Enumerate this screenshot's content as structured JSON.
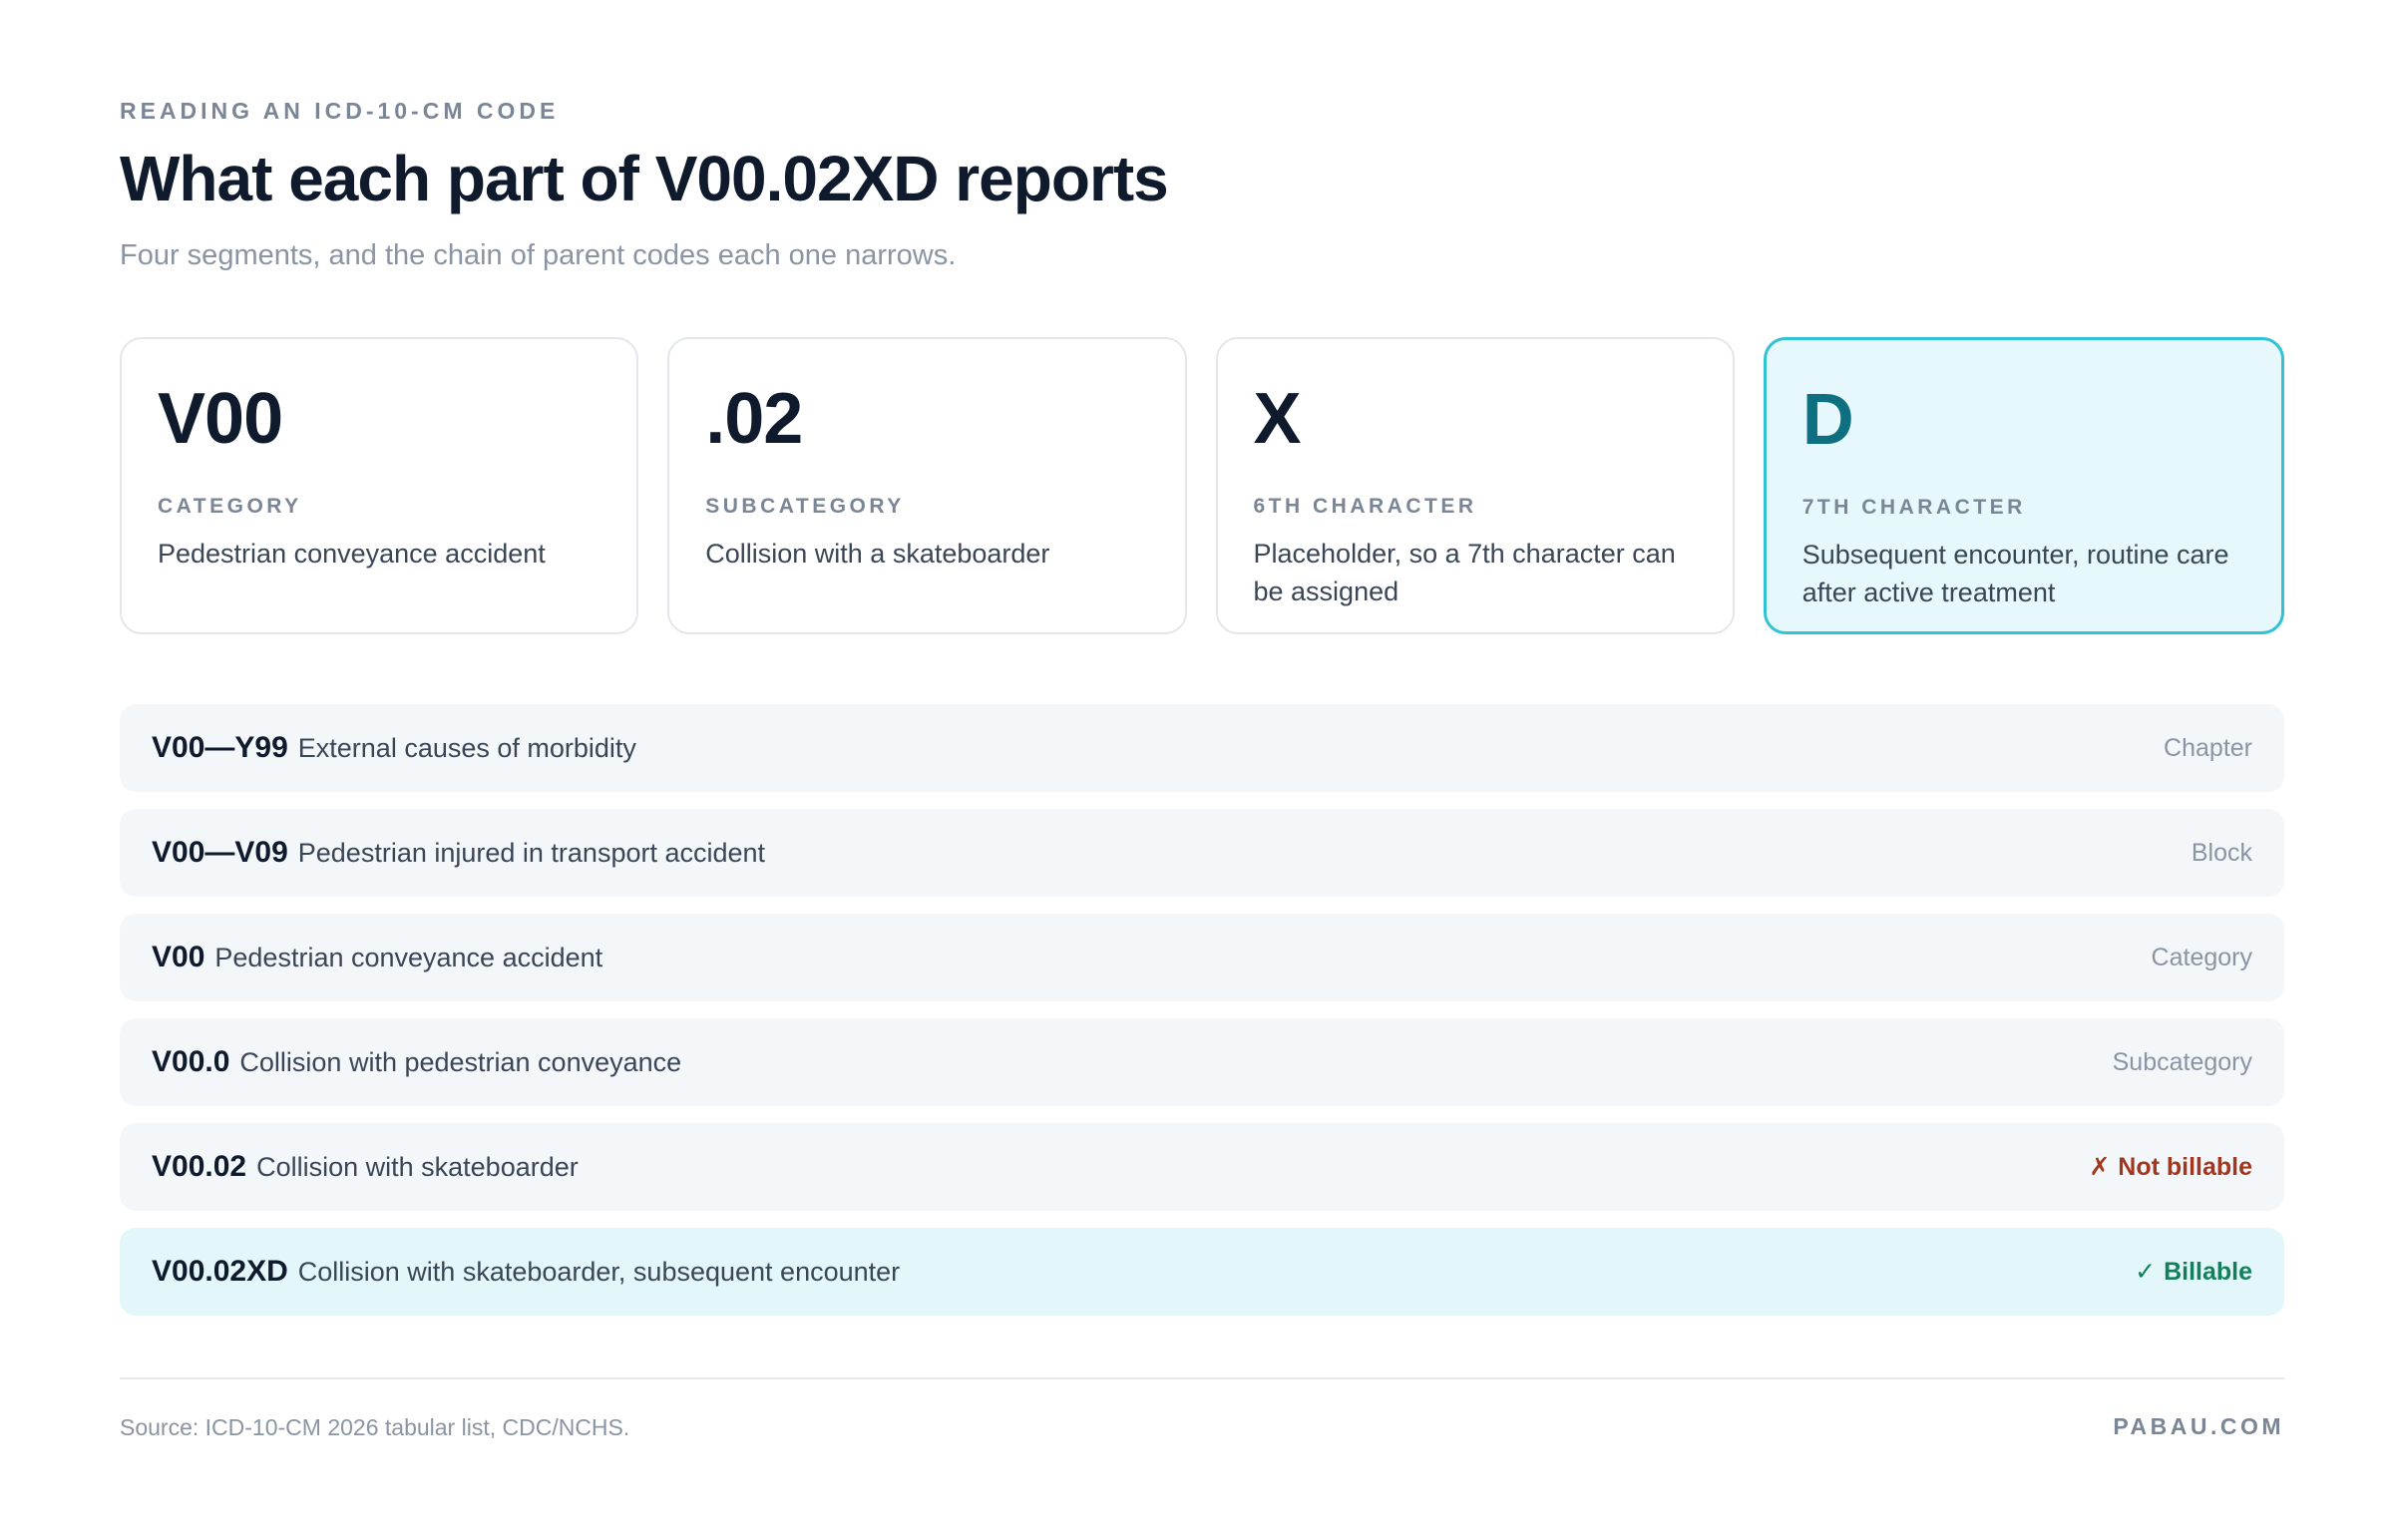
{
  "header": {
    "eyebrow": "READING AN ICD-10-CM CODE",
    "title": "What each part of V00.02XD reports",
    "subtitle": "Four segments, and the chain of parent codes each one narrows."
  },
  "segments": [
    {
      "code": "V00",
      "label": "CATEGORY",
      "description": "Pedestrian conveyance accident",
      "highlighted": false
    },
    {
      "code": ".02",
      "label": "SUBCATEGORY",
      "description": "Collision with a skateboarder",
      "highlighted": false
    },
    {
      "code": "X",
      "label": "6TH CHARACTER",
      "description": "Placeholder, so a 7th character can be assigned",
      "highlighted": false
    },
    {
      "code": "D",
      "label": "7TH CHARACTER",
      "description": "Subsequent encounter, routine care after active treatment",
      "highlighted": true
    }
  ],
  "hierarchy": [
    {
      "code": "V00—Y99",
      "description": "External causes of morbidity",
      "level": "Chapter",
      "status": "",
      "mark": ""
    },
    {
      "code": "V00—V09",
      "description": "Pedestrian injured in transport accident",
      "level": "Block",
      "status": "",
      "mark": ""
    },
    {
      "code": "V00",
      "description": "Pedestrian conveyance accident",
      "level": "Category",
      "status": "",
      "mark": ""
    },
    {
      "code": "V00.0",
      "description": "Collision with pedestrian conveyance",
      "level": "Subcategory",
      "status": "",
      "mark": ""
    },
    {
      "code": "V00.02",
      "description": "Collision with skateboarder",
      "level": "Not billable",
      "status": "not-billable",
      "mark": "✗"
    },
    {
      "code": "V00.02XD",
      "description": "Collision with skateboarder, subsequent encounter",
      "level": "Billable",
      "status": "billable",
      "mark": "✓"
    }
  ],
  "colors": {
    "accent": "#33c2d4",
    "accent_text": "#0d6f80",
    "not_billable": "#a2371f",
    "billable": "#12805a"
  },
  "footer": {
    "source": "Source: ICD-10-CM 2026 tabular list, CDC/NCHS.",
    "brand": "PABAU.COM"
  }
}
